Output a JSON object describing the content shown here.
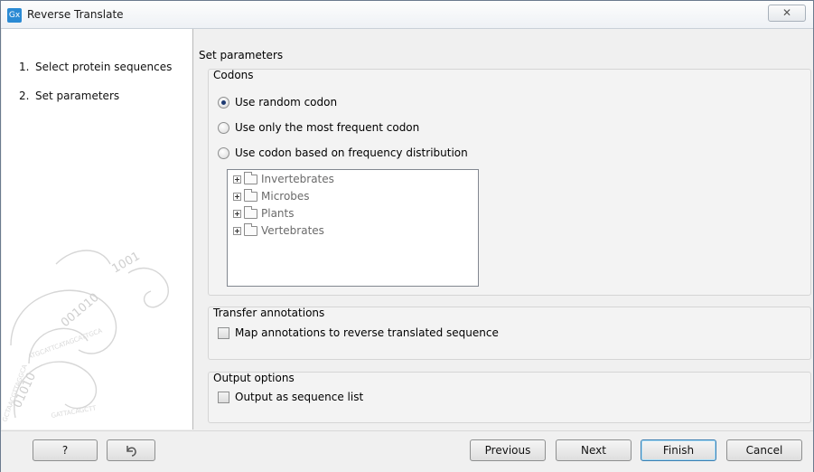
{
  "window": {
    "title": "Reverse Translate",
    "app_icon_text": "Gx",
    "close_symbol": "✕"
  },
  "sidebar": {
    "steps": [
      {
        "number": "1.",
        "label": "Select protein sequences"
      },
      {
        "number": "2.",
        "label": "Set parameters"
      }
    ]
  },
  "main": {
    "section_title": "Set parameters",
    "codons": {
      "label": "Codons",
      "options": [
        {
          "label": "Use random codon",
          "checked": true
        },
        {
          "label": "Use only the most frequent codon",
          "checked": false
        },
        {
          "label": "Use codon based on frequency distribution",
          "checked": false
        }
      ],
      "tree": [
        "Invertebrates",
        "Microbes",
        "Plants",
        "Vertebrates"
      ]
    },
    "transfer": {
      "label": "Transfer annotations",
      "checkbox_label": "Map annotations to reverse translated sequence",
      "checked": false
    },
    "output": {
      "label": "Output options",
      "checkbox_label": "Output as sequence list",
      "checked": false
    }
  },
  "footer": {
    "help_label": "?",
    "previous_label": "Previous",
    "next_label": "Next",
    "finish_label": "Finish",
    "cancel_label": "Cancel"
  },
  "colors": {
    "accent": "#2a8ad4",
    "default_button_border": "#3c7fb1"
  }
}
